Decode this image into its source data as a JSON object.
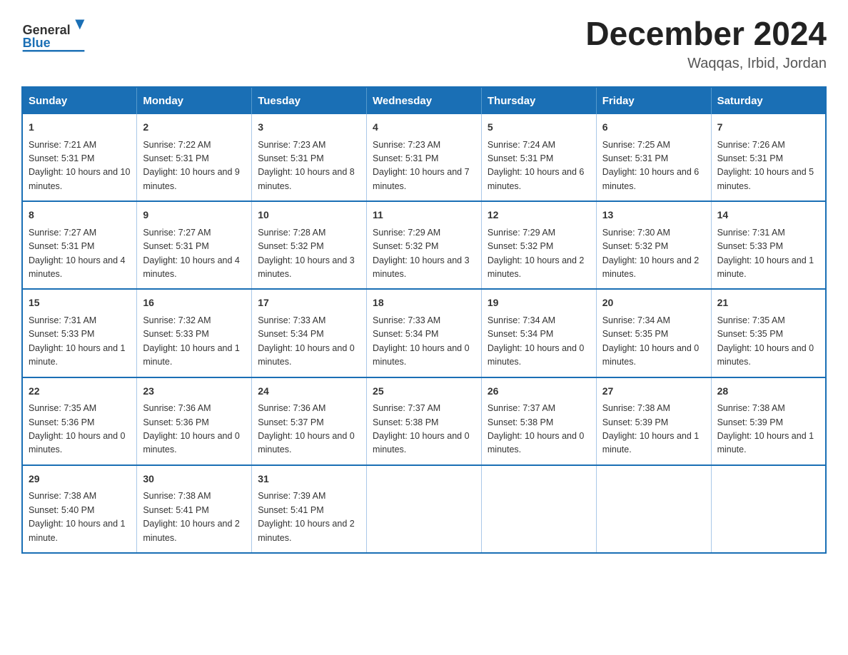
{
  "header": {
    "logo_general": "General",
    "logo_blue": "Blue",
    "month_title": "December 2024",
    "location": "Waqqas, Irbid, Jordan"
  },
  "days_of_week": [
    "Sunday",
    "Monday",
    "Tuesday",
    "Wednesday",
    "Thursday",
    "Friday",
    "Saturday"
  ],
  "weeks": [
    [
      {
        "day": "1",
        "sunrise": "7:21 AM",
        "sunset": "5:31 PM",
        "daylight": "10 hours and 10 minutes."
      },
      {
        "day": "2",
        "sunrise": "7:22 AM",
        "sunset": "5:31 PM",
        "daylight": "10 hours and 9 minutes."
      },
      {
        "day": "3",
        "sunrise": "7:23 AM",
        "sunset": "5:31 PM",
        "daylight": "10 hours and 8 minutes."
      },
      {
        "day": "4",
        "sunrise": "7:23 AM",
        "sunset": "5:31 PM",
        "daylight": "10 hours and 7 minutes."
      },
      {
        "day": "5",
        "sunrise": "7:24 AM",
        "sunset": "5:31 PM",
        "daylight": "10 hours and 6 minutes."
      },
      {
        "day": "6",
        "sunrise": "7:25 AM",
        "sunset": "5:31 PM",
        "daylight": "10 hours and 6 minutes."
      },
      {
        "day": "7",
        "sunrise": "7:26 AM",
        "sunset": "5:31 PM",
        "daylight": "10 hours and 5 minutes."
      }
    ],
    [
      {
        "day": "8",
        "sunrise": "7:27 AM",
        "sunset": "5:31 PM",
        "daylight": "10 hours and 4 minutes."
      },
      {
        "day": "9",
        "sunrise": "7:27 AM",
        "sunset": "5:31 PM",
        "daylight": "10 hours and 4 minutes."
      },
      {
        "day": "10",
        "sunrise": "7:28 AM",
        "sunset": "5:32 PM",
        "daylight": "10 hours and 3 minutes."
      },
      {
        "day": "11",
        "sunrise": "7:29 AM",
        "sunset": "5:32 PM",
        "daylight": "10 hours and 3 minutes."
      },
      {
        "day": "12",
        "sunrise": "7:29 AM",
        "sunset": "5:32 PM",
        "daylight": "10 hours and 2 minutes."
      },
      {
        "day": "13",
        "sunrise": "7:30 AM",
        "sunset": "5:32 PM",
        "daylight": "10 hours and 2 minutes."
      },
      {
        "day": "14",
        "sunrise": "7:31 AM",
        "sunset": "5:33 PM",
        "daylight": "10 hours and 1 minute."
      }
    ],
    [
      {
        "day": "15",
        "sunrise": "7:31 AM",
        "sunset": "5:33 PM",
        "daylight": "10 hours and 1 minute."
      },
      {
        "day": "16",
        "sunrise": "7:32 AM",
        "sunset": "5:33 PM",
        "daylight": "10 hours and 1 minute."
      },
      {
        "day": "17",
        "sunrise": "7:33 AM",
        "sunset": "5:34 PM",
        "daylight": "10 hours and 0 minutes."
      },
      {
        "day": "18",
        "sunrise": "7:33 AM",
        "sunset": "5:34 PM",
        "daylight": "10 hours and 0 minutes."
      },
      {
        "day": "19",
        "sunrise": "7:34 AM",
        "sunset": "5:34 PM",
        "daylight": "10 hours and 0 minutes."
      },
      {
        "day": "20",
        "sunrise": "7:34 AM",
        "sunset": "5:35 PM",
        "daylight": "10 hours and 0 minutes."
      },
      {
        "day": "21",
        "sunrise": "7:35 AM",
        "sunset": "5:35 PM",
        "daylight": "10 hours and 0 minutes."
      }
    ],
    [
      {
        "day": "22",
        "sunrise": "7:35 AM",
        "sunset": "5:36 PM",
        "daylight": "10 hours and 0 minutes."
      },
      {
        "day": "23",
        "sunrise": "7:36 AM",
        "sunset": "5:36 PM",
        "daylight": "10 hours and 0 minutes."
      },
      {
        "day": "24",
        "sunrise": "7:36 AM",
        "sunset": "5:37 PM",
        "daylight": "10 hours and 0 minutes."
      },
      {
        "day": "25",
        "sunrise": "7:37 AM",
        "sunset": "5:38 PM",
        "daylight": "10 hours and 0 minutes."
      },
      {
        "day": "26",
        "sunrise": "7:37 AM",
        "sunset": "5:38 PM",
        "daylight": "10 hours and 0 minutes."
      },
      {
        "day": "27",
        "sunrise": "7:38 AM",
        "sunset": "5:39 PM",
        "daylight": "10 hours and 1 minute."
      },
      {
        "day": "28",
        "sunrise": "7:38 AM",
        "sunset": "5:39 PM",
        "daylight": "10 hours and 1 minute."
      }
    ],
    [
      {
        "day": "29",
        "sunrise": "7:38 AM",
        "sunset": "5:40 PM",
        "daylight": "10 hours and 1 minute."
      },
      {
        "day": "30",
        "sunrise": "7:38 AM",
        "sunset": "5:41 PM",
        "daylight": "10 hours and 2 minutes."
      },
      {
        "day": "31",
        "sunrise": "7:39 AM",
        "sunset": "5:41 PM",
        "daylight": "10 hours and 2 minutes."
      },
      null,
      null,
      null,
      null
    ]
  ],
  "labels": {
    "sunrise": "Sunrise:",
    "sunset": "Sunset:",
    "daylight": "Daylight:"
  }
}
